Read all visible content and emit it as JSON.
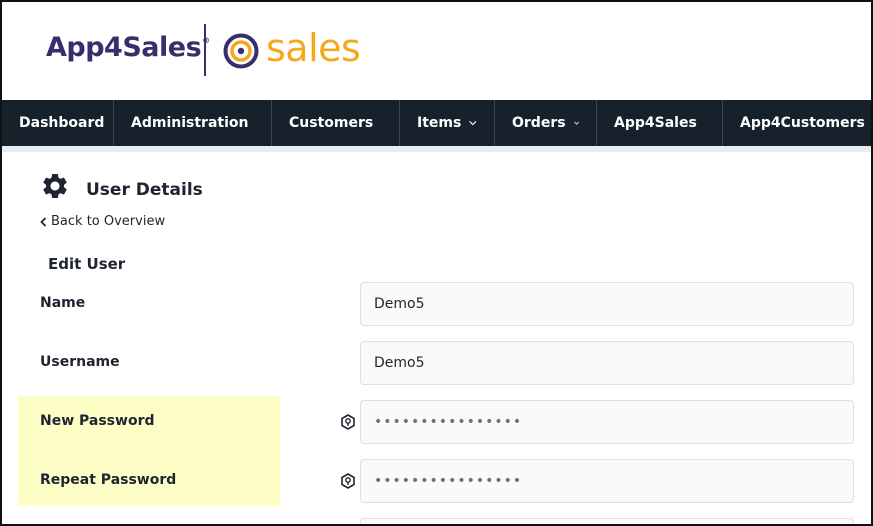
{
  "header": {
    "logo_primary": "App4Sales",
    "logo_primary_mark": "®",
    "logo_secondary": "sales"
  },
  "nav": {
    "items": [
      {
        "label": "Dashboard",
        "has_dropdown": false
      },
      {
        "label": "Administration",
        "has_dropdown": true
      },
      {
        "label": "Customers",
        "has_dropdown": true
      },
      {
        "label": "Items",
        "has_dropdown": true
      },
      {
        "label": "Orders",
        "has_dropdown": true
      },
      {
        "label": "App4Sales",
        "has_dropdown": true
      },
      {
        "label": "App4Customers",
        "has_dropdown": true
      }
    ]
  },
  "page": {
    "icon": "gear-icon",
    "title": "User Details",
    "back_link": "Back to Overview",
    "section_title": "Edit User"
  },
  "form": {
    "fields": [
      {
        "label": "Name",
        "value": "Demo5",
        "type": "text"
      },
      {
        "label": "Username",
        "value": "Demo5",
        "type": "text"
      },
      {
        "label": "New Password",
        "value": "••••••••••••••••",
        "type": "password",
        "icon": "password-generate-icon"
      },
      {
        "label": "Repeat Password",
        "value": "••••••••••••••••",
        "type": "password",
        "icon": "password-generate-icon"
      }
    ]
  },
  "colors": {
    "nav_bg": "#16212c",
    "brand_purple": "#3a2d6b",
    "brand_orange": "#f5a81c",
    "highlight": "#fdfdc6"
  }
}
